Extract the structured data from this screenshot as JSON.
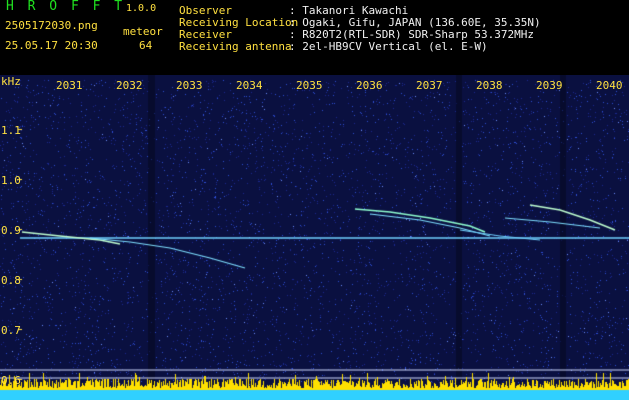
{
  "header": {
    "app_title": "H R O F F T",
    "version": "1.0.0",
    "filename": "2505172030.png",
    "datetime": "25.05.17 20:30",
    "count_label": "meteor",
    "count_value": "64",
    "info_labels": [
      "Observer",
      "Receiving Location",
      "Receiver",
      "Receiving antenna"
    ],
    "info_values": [
      ": Takanori Kawachi",
      ": Ogaki, Gifu, JAPAN (136.60E, 35.35N)",
      ": R820T2(RTL-SDR) SDR-Sharp 53.372MHz",
      ": 2el-HB9CV Vertical (el. E-W)"
    ]
  },
  "spectrogram": {
    "y_unit": "kHz",
    "y_ticks": [
      "1.1",
      "1.0",
      "0.9",
      "0.8",
      "0.7",
      "0.6"
    ],
    "x_ticks": [
      "2031",
      "2032",
      "2033",
      "2034",
      "2035",
      "2036",
      "2037",
      "2038",
      "2039",
      "2040"
    ],
    "colors": {
      "background": "#0a1040",
      "noise": "#2f4fd6",
      "carrier": "#6fd0ff",
      "trail": "#bfffd0",
      "power_bar": "#ffe000",
      "floor": "#30d0ff"
    }
  }
}
